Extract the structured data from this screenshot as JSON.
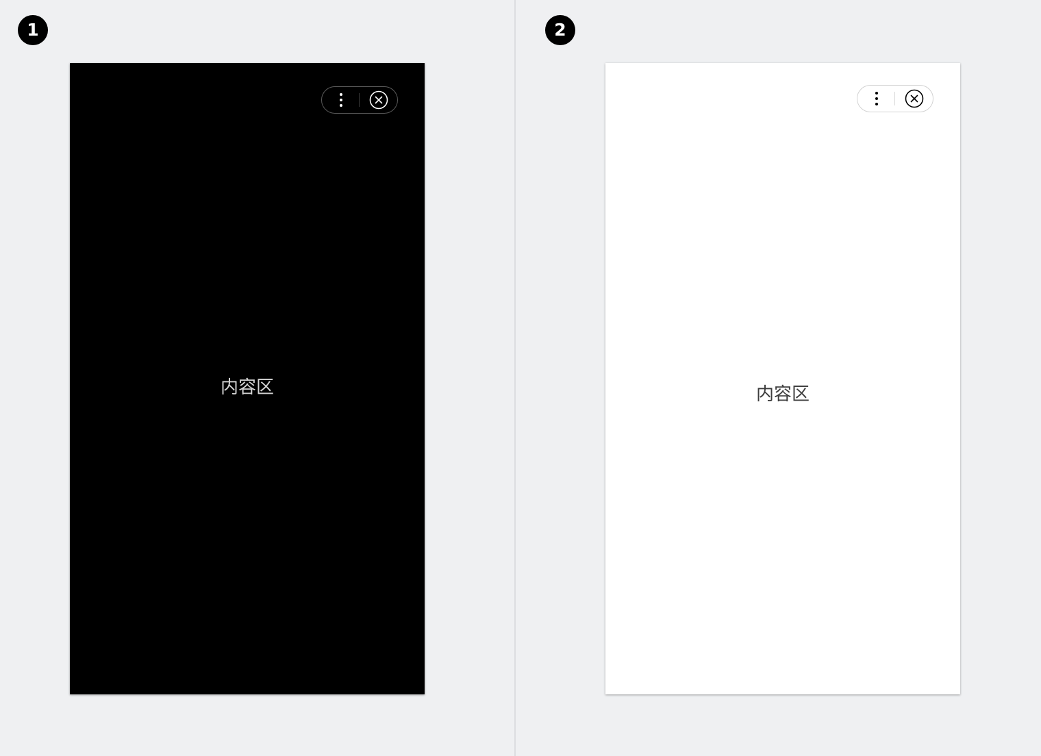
{
  "screens": [
    {
      "marker": "1",
      "theme": "dark",
      "background": "#000000",
      "capsule": {
        "menu_icon": "more-vertical-icon",
        "close_icon": "close-circle-icon",
        "icon_color": "#ffffff"
      },
      "content_label": "内容区"
    },
    {
      "marker": "2",
      "theme": "light",
      "background": "#ffffff",
      "capsule": {
        "menu_icon": "more-vertical-icon",
        "close_icon": "close-circle-icon",
        "icon_color": "#000000"
      },
      "content_label": "内容区"
    }
  ]
}
